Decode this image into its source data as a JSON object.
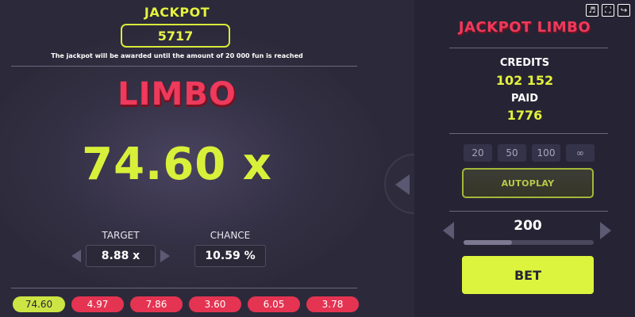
{
  "jackpot": {
    "title": "JACKPOT",
    "amount": "5717",
    "note": "The jackpot will be awarded until the amount of 20 000 fun is reached"
  },
  "game": {
    "logo": "LIMBO",
    "multiplier": "74.60 x",
    "target_label": "TARGET",
    "target_value": "8.88 x",
    "chance_label": "CHANCE",
    "chance_value": "10.59 %"
  },
  "history": [
    {
      "value": "74.60",
      "status": "win"
    },
    {
      "value": "4.97",
      "status": "lose"
    },
    {
      "value": "7.86",
      "status": "lose"
    },
    {
      "value": "3.60",
      "status": "lose"
    },
    {
      "value": "6.05",
      "status": "lose"
    },
    {
      "value": "3.78",
      "status": "lose"
    }
  ],
  "panel": {
    "logo": "JACKPOT LIMBO",
    "credits_label": "CREDITS",
    "credits_value": "102 152",
    "paid_label": "PAID",
    "paid_value": "1776",
    "quick_options": [
      "20",
      "50",
      "100",
      "∞"
    ],
    "autoplay_label": "AUTOPLAY",
    "bet_value": "200",
    "bet_slider_fraction": 0.37,
    "bet_button": "BET"
  },
  "icons": {
    "top": [
      "sound-icon",
      "fullscreen-icon",
      "exit-icon"
    ]
  },
  "colors": {
    "accent_yellow": "#dcf43e",
    "brand_red": "#ee3a5c",
    "lose_pill": "#e43452",
    "win_pill": "#cce544"
  }
}
